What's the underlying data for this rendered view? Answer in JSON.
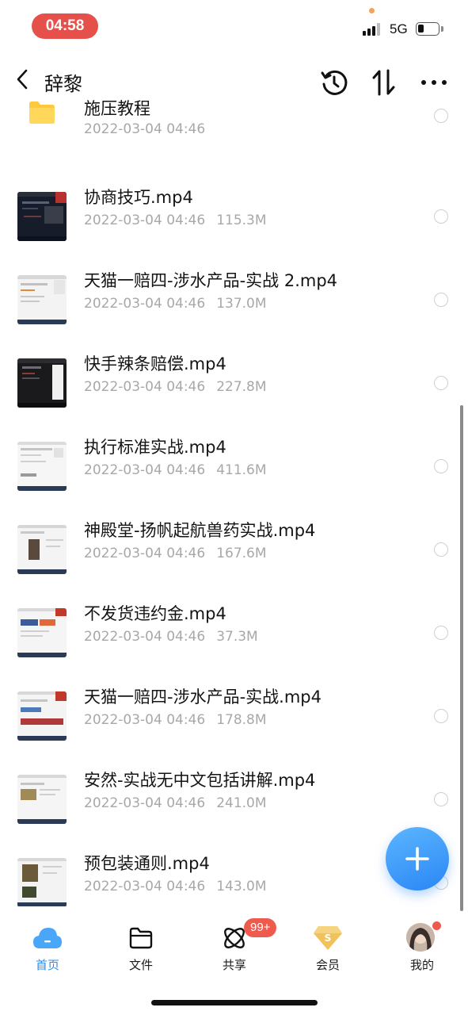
{
  "status_bar": {
    "time": "04:58",
    "network": "5G",
    "signal_bars": 4,
    "signal_bars_active": 3,
    "battery_level": 0.2,
    "colors": {
      "time_pill": "#e5504a"
    }
  },
  "nav": {
    "title": "辞黎",
    "back_icon": "chevron-left-icon",
    "history_icon": "history-icon",
    "sort_icon": "sort-icon",
    "more_icon": "more-icon"
  },
  "files": [
    {
      "name": "施压教程",
      "date": "2022-03-04 04:46",
      "size": "",
      "type": "folder"
    },
    {
      "name": "协商技巧.mp4",
      "date": "2022-03-04 04:46",
      "size": "115.3M",
      "type": "video",
      "thumb": "dark"
    },
    {
      "name": "天猫一赔四-涉水产品-实战 2.mp4",
      "date": "2022-03-04 04:46",
      "size": "137.0M",
      "type": "video",
      "thumb": "light"
    },
    {
      "name": "快手辣条赔偿.mp4",
      "date": "2022-03-04 04:46",
      "size": "227.8M",
      "type": "video",
      "thumb": "dark"
    },
    {
      "name": "执行标准实战.mp4",
      "date": "2022-03-04 04:46",
      "size": "411.6M",
      "type": "video",
      "thumb": "light"
    },
    {
      "name": "神殿堂-扬帆起航兽药实战.mp4",
      "date": "2022-03-04 04:46",
      "size": "167.6M",
      "type": "video",
      "thumb": "light"
    },
    {
      "name": "不发货违约金.mp4",
      "date": "2022-03-04 04:46",
      "size": "37.3M",
      "type": "video",
      "thumb": "light"
    },
    {
      "name": "天猫一赔四-涉水产品-实战.mp4",
      "date": "2022-03-04 04:46",
      "size": "178.8M",
      "type": "video",
      "thumb": "light"
    },
    {
      "name": "安然-实战无中文包括讲解.mp4",
      "date": "2022-03-04 04:46",
      "size": "241.0M",
      "type": "video",
      "thumb": "light"
    },
    {
      "name": "预包装通则.mp4",
      "date": "2022-03-04 04:46",
      "size": "143.0M",
      "type": "video",
      "thumb": "light"
    }
  ],
  "fab": {
    "icon": "plus-icon",
    "color": "#2f8cf0"
  },
  "tabs": [
    {
      "label": "首页",
      "icon": "cloud-icon",
      "active": true
    },
    {
      "label": "文件",
      "icon": "folder-icon",
      "active": false
    },
    {
      "label": "共享",
      "icon": "share-orbit-icon",
      "active": false,
      "badge": "99+"
    },
    {
      "label": "会员",
      "icon": "vip-diamond-icon",
      "active": false
    },
    {
      "label": "我的",
      "icon": "avatar-icon",
      "active": false
    }
  ],
  "colors": {
    "accent": "#2f8cf0",
    "badge": "#ef5a4f",
    "meta_text": "#a8a8a8"
  }
}
